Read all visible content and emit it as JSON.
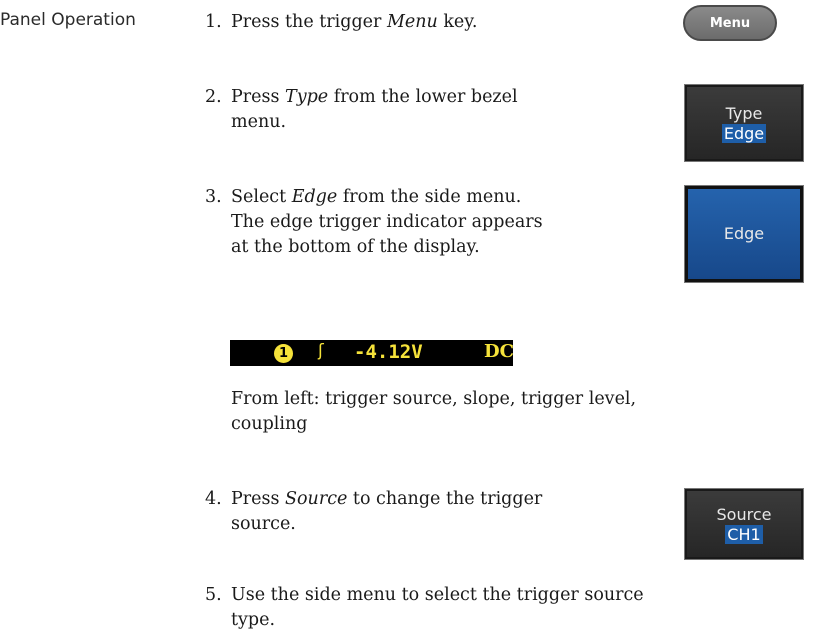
{
  "section_label": "Panel Operation",
  "steps": [
    {
      "num": "1.",
      "pre": "Press the trigger ",
      "em": "Menu",
      "post": " key."
    },
    {
      "num": "2.",
      "pre": "Press ",
      "em": "Type",
      "post": " from the lower bezel",
      "line2": "menu."
    },
    {
      "num": "3.",
      "pre": "Select ",
      "em": "Edge",
      "post": " from the side menu.",
      "line2": "The edge trigger indicator appears",
      "line3": "at the bottom of the display."
    },
    {
      "num": "4.",
      "pre": "Press ",
      "em": "Source",
      "post": " to change the trigger",
      "line2": "source."
    },
    {
      "num": "5.",
      "line1": "Use the side menu to select the trigger source",
      "line2": "type."
    }
  ],
  "note": {
    "line1": "From left: trigger source, slope, trigger level,",
    "line2": "coupling"
  },
  "buttons": {
    "menu_key": "Menu",
    "type_bezel": {
      "label": "Type",
      "value": "Edge"
    },
    "edge_bezel": {
      "label": "Edge"
    },
    "source_bezel": {
      "label": "Source",
      "value": "CH1"
    }
  },
  "trigger_indicator": {
    "source": "1",
    "slope_icon": "rising-edge-icon",
    "slope_glyph": "ʃ",
    "level": "-4.12V",
    "coupling": "DC"
  },
  "colors": {
    "bezel_highlight": "#1e5ea8",
    "indicator_yellow": "#f5e23a"
  }
}
